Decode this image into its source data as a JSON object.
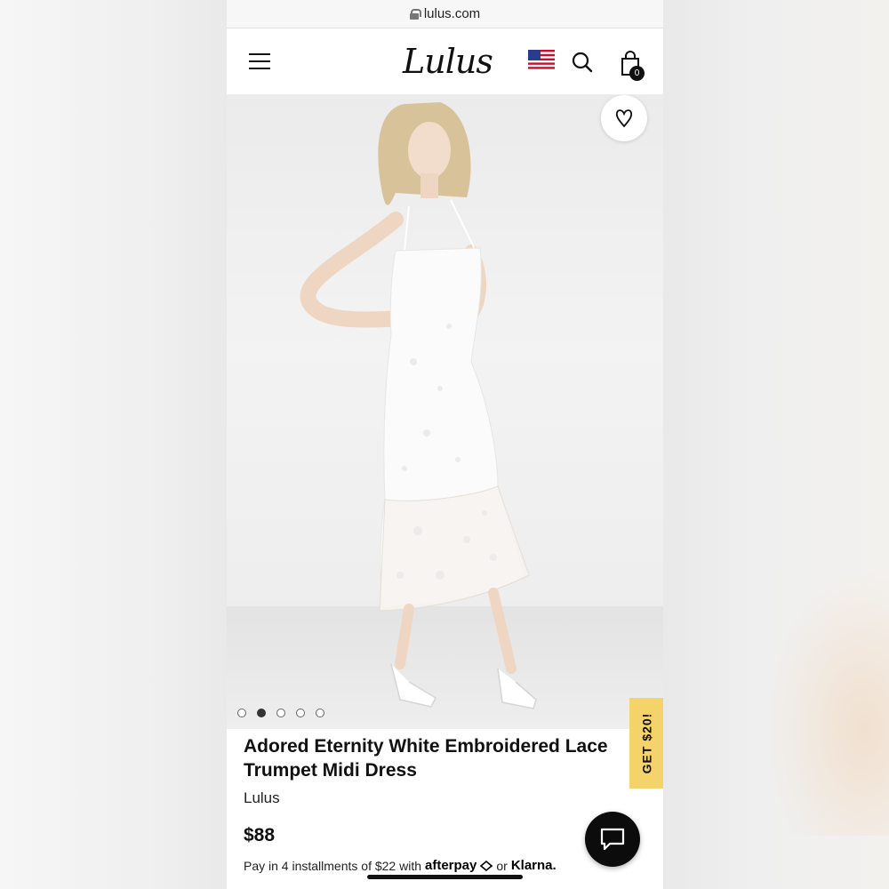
{
  "browser": {
    "url": "lulus.com"
  },
  "header": {
    "logo_text": "Lulus",
    "cart_count": "0",
    "icons": [
      "menu-icon",
      "us-flag-icon",
      "search-icon",
      "shopping-bag-icon"
    ]
  },
  "product": {
    "title": "Adored Eternity White Embroidered Lace Trumpet Midi Dress",
    "brand": "Lulus",
    "price": "$88",
    "image_count": 5,
    "active_image_index": 1
  },
  "payment": {
    "prefix": "Pay in 4 installments of $22 with",
    "afterpay": "afterpay",
    "separator": "or",
    "klarna": "Klarna."
  },
  "promo": {
    "label": "GET $20!"
  },
  "colors": {
    "promo_bg": "#f5d36b",
    "chat_bg": "#0c0c0c",
    "text": "#111111"
  }
}
